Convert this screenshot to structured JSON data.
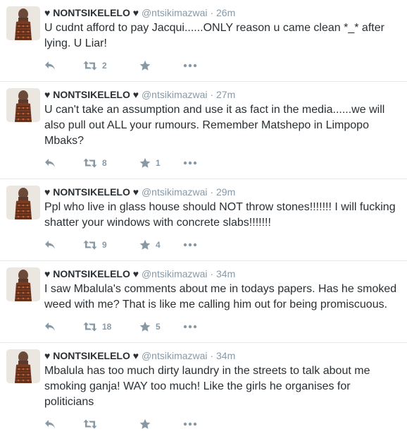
{
  "icons": {
    "reply": "reply-icon",
    "retweet": "retweet-icon",
    "favorite": "favorite-star-icon",
    "more": "more-dots-icon"
  },
  "colors": {
    "icon_gray": "#8899a6",
    "text": "#292f33",
    "divider": "#e1e8ed"
  },
  "tweets": [
    {
      "name": "♥ NONTSIKELELO ♥",
      "handle": "@ntsikimazwai",
      "time": "26m",
      "text": "U cudnt afford to pay Jacqui......ONLY reason u came clean *_* after lying. U Liar!",
      "retweets": "2",
      "favorites": ""
    },
    {
      "name": "♥ NONTSIKELELO ♥",
      "handle": "@ntsikimazwai",
      "time": "27m",
      "text": "U can't take an assumption and use it as fact in the media......we will also pull out ALL your rumours. Remember Matshepo in Limpopo Mbaks?",
      "retweets": "8",
      "favorites": "1"
    },
    {
      "name": "♥ NONTSIKELELO ♥",
      "handle": "@ntsikimazwai",
      "time": "29m",
      "text": "Ppl who live in glass house should NOT throw stones!!!!!!! I will fucking shatter your windows with concrete slabs!!!!!!!",
      "retweets": "9",
      "favorites": "4"
    },
    {
      "name": "♥ NONTSIKELELO ♥",
      "handle": "@ntsikimazwai",
      "time": "34m",
      "text": "I saw Mbalula's comments about me in todays papers. Has he smoked weed with me? That is like me calling him out for being promiscuous.",
      "retweets": "18",
      "favorites": "5"
    },
    {
      "name": "♥ NONTSIKELELO ♥",
      "handle": "@ntsikimazwai",
      "time": "34m",
      "text": "Mbalula has too much dirty laundry in the streets to talk about me smoking ganja! WAY too much! Like the girls he organises for politicians",
      "retweets": "",
      "favorites": ""
    }
  ]
}
